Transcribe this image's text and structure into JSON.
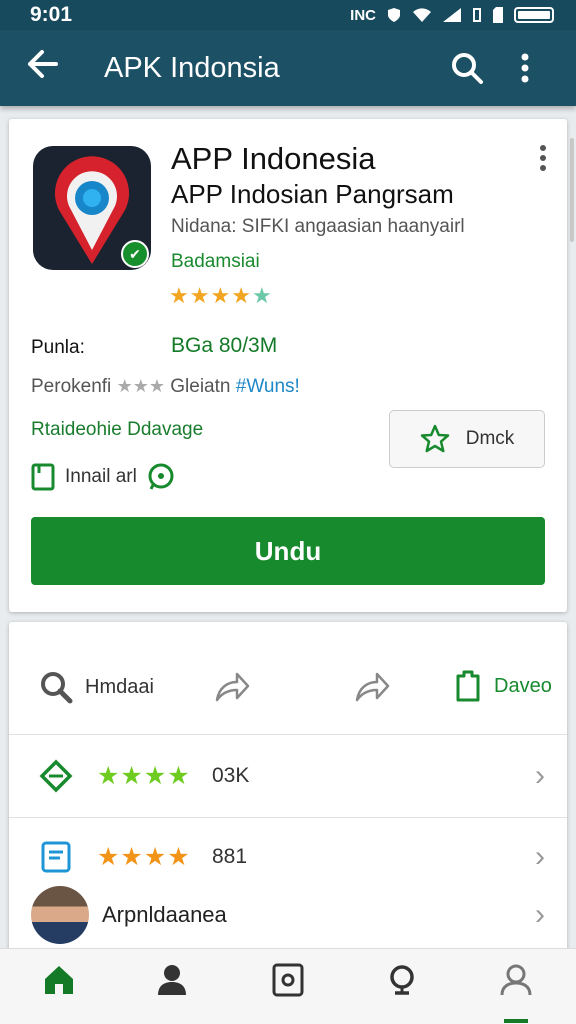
{
  "status_bar": {
    "time": "9:01",
    "network_text": "INC"
  },
  "app_bar": {
    "title": "APK Indonsia"
  },
  "app": {
    "name": "APP Indonesia",
    "subtitle": "APP Indosian Pangrsam",
    "developer": "Nidana: SIFKI angaasian haanyairl",
    "category": "Badamsiai",
    "rating_stars": 4
  },
  "details": {
    "price_label": "Punla:",
    "price_value": "BGa 80/3M",
    "permission_label": "Perokenfi",
    "permission_extra": "Gleiatn",
    "permission_link": "#Wuns!",
    "feature_text": "Rtaideohie Ddavage",
    "favorite_button": "Dmck",
    "install_text": "Innail arl",
    "download_button": "Undu"
  },
  "actions": {
    "search_label": "Hmdaai",
    "save_label": "Daveo"
  },
  "list": [
    {
      "stars": 4,
      "count": "03K",
      "star_color": "#6ecb1f"
    },
    {
      "stars": 4,
      "count": "881",
      "star_color": "#f29418"
    },
    {
      "title": "Arpnldaanea"
    }
  ],
  "colors": {
    "primary": "#1c5064",
    "accent": "#178a2e",
    "star": "#f2a521"
  }
}
